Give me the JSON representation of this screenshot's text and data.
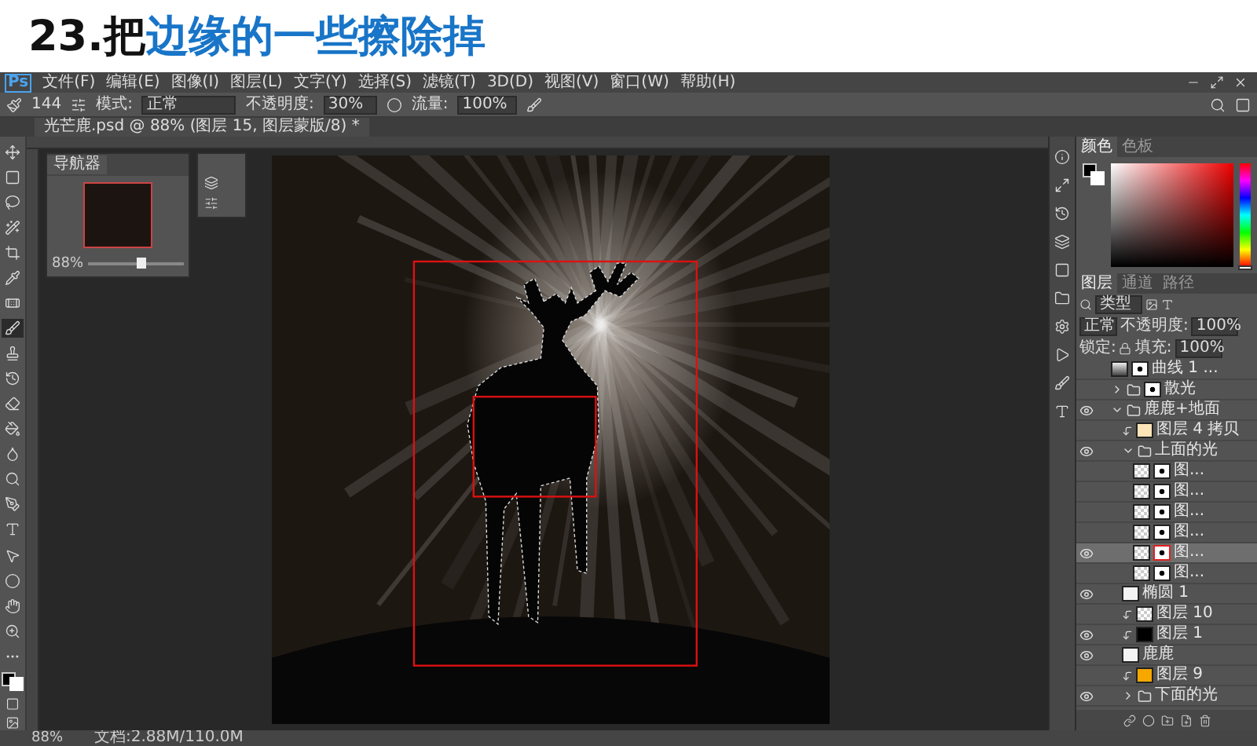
{
  "header": {
    "title_prefix": "23.把",
    "title_highlight": "边缘的一些擦除掉"
  },
  "app_logo": "Ps",
  "menu": [
    "文件(F)",
    "编辑(E)",
    "图像(I)",
    "图层(L)",
    "文字(Y)",
    "选择(S)",
    "滤镜(T)",
    "3D(D)",
    "视图(V)",
    "窗口(W)",
    "帮助(H)"
  ],
  "options": {
    "brush_size": "144",
    "mode_label": "模式:",
    "mode": "正常",
    "opacity_label": "不透明度:",
    "opacity": "30%",
    "flow_label": "流量:",
    "flow": "100%"
  },
  "document_tab": {
    "title": "光芒鹿.psd @ 88% (图层 15, 图层蒙版/8) *"
  },
  "navigator": {
    "title": "导航器",
    "zoom": "88%",
    "level": 0.55
  },
  "color_panel": {
    "tabs": [
      {
        "label": "颜色",
        "selected": true
      },
      {
        "label": "色板",
        "selected": false
      }
    ],
    "hue": {
      "level": 0
    }
  },
  "layers_panel": {
    "tabs": [
      {
        "label": "图层",
        "selected": true
      },
      {
        "label": "通道",
        "selected": false
      },
      {
        "label": "路径",
        "selected": false
      }
    ],
    "filter": "类型",
    "blend_mode": "正常",
    "opacity_label": "不透明度:",
    "opacity": "100%",
    "lock_label": "锁定:",
    "fill_label": "填充:",
    "fill": "100%",
    "layers": [
      {
        "kind": "photo",
        "name": "曲线 1 ...",
        "visible": false,
        "selected": false,
        "mask": true,
        "clipped": false
      },
      {
        "kind": "group",
        "name": "散光",
        "visible": false,
        "selected": false,
        "expanded": false,
        "mask": true
      },
      {
        "kind": "group",
        "name": "鹿鹿+地面",
        "visible": true,
        "selected": false,
        "expanded": true,
        "mask": false,
        "children": [
          {
            "kind": "cream",
            "name": "图层 4 拷贝",
            "visible": false,
            "selected": false,
            "mask": false,
            "clipped": true
          },
          {
            "kind": "group",
            "name": "上面的光",
            "visible": true,
            "selected": false,
            "expanded": true,
            "mask": false,
            "children": [
              {
                "kind": "checker",
                "name": "图...",
                "visible": false,
                "selected": false,
                "mask": true,
                "clipped": false
              },
              {
                "kind": "checker",
                "name": "图...",
                "visible": false,
                "selected": false,
                "mask": true,
                "clipped": false
              },
              {
                "kind": "checker",
                "name": "图...",
                "visible": false,
                "selected": false,
                "mask": true,
                "clipped": false
              },
              {
                "kind": "checker",
                "name": "图...",
                "visible": false,
                "selected": false,
                "mask": true,
                "clipped": false
              },
              {
                "kind": "checker",
                "name": "图...",
                "visible": true,
                "selected": true,
                "mask": true,
                "clipped": false
              },
              {
                "kind": "checker",
                "name": "图...",
                "visible": false,
                "selected": false,
                "mask": true,
                "clipped": false
              }
            ]
          },
          {
            "kind": "white",
            "name": "椭圆 1",
            "visible": true,
            "selected": false,
            "mask": false,
            "clipped": false
          },
          {
            "kind": "checker",
            "name": "图层 10",
            "visible": false,
            "selected": false,
            "mask": false,
            "clipped": true
          },
          {
            "kind": "black",
            "name": "图层 1",
            "visible": true,
            "selected": false,
            "mask": false,
            "clipped": true
          },
          {
            "kind": "white",
            "name": "鹿鹿",
            "visible": true,
            "selected": false,
            "mask": false,
            "clipped": false
          },
          {
            "kind": "orange",
            "name": "图层 9",
            "visible": false,
            "selected": false,
            "mask": false,
            "clipped": true
          },
          {
            "kind": "group",
            "name": "下面的光",
            "visible": true,
            "selected": false,
            "expanded": false,
            "mask": false
          }
        ]
      }
    ]
  },
  "status_bar": {
    "zoom": "88%",
    "doc_size": "文档:2.88M/110.0M"
  }
}
